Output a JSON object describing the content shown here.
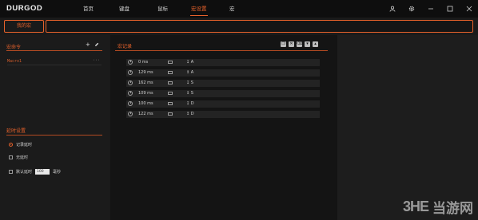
{
  "app": {
    "brand": "DURGOD"
  },
  "nav": {
    "items": [
      {
        "label": "首页"
      },
      {
        "label": "键盘"
      },
      {
        "label": "鼠标"
      },
      {
        "label": "宏设置",
        "active": true
      },
      {
        "label": "宏"
      }
    ]
  },
  "window_icons": [
    "user-icon",
    "gear-icon",
    "minimize-icon",
    "maximize-icon",
    "close-icon"
  ],
  "profile": {
    "tab_label": "我的宏",
    "field_value": ""
  },
  "macro_list": {
    "title": "宏命令",
    "add_symbol": "+",
    "items": [
      {
        "name": "Macro1",
        "more": "···"
      }
    ]
  },
  "delay_settings": {
    "title": "延时设置",
    "options": [
      {
        "label": "记录延时",
        "selected": true
      },
      {
        "label": "无延时",
        "selected": false
      },
      {
        "label": "默认延时",
        "selected": false
      }
    ],
    "default_value": "100",
    "unit": "毫秒"
  },
  "record": {
    "title": "宏记录",
    "tool_icons": [
      "copy-icon",
      "delete-icon",
      "clear-icon",
      "move-down-icon",
      "move-up-icon"
    ],
    "rows": [
      {
        "time": "0 ms",
        "key": "↧ A"
      },
      {
        "time": "129 ms",
        "key": "↥ A"
      },
      {
        "time": "162 ms",
        "key": "↧ S"
      },
      {
        "time": "109 ms",
        "key": "↥ S"
      },
      {
        "time": "100 ms",
        "key": "↧ D"
      },
      {
        "time": "122 ms",
        "key": "↥ D"
      }
    ]
  },
  "watermark": {
    "logo": "3HE",
    "text": "当游网"
  },
  "colors": {
    "accent": "#e8622b",
    "background": "#141414",
    "panel": "#1b1b1b"
  }
}
